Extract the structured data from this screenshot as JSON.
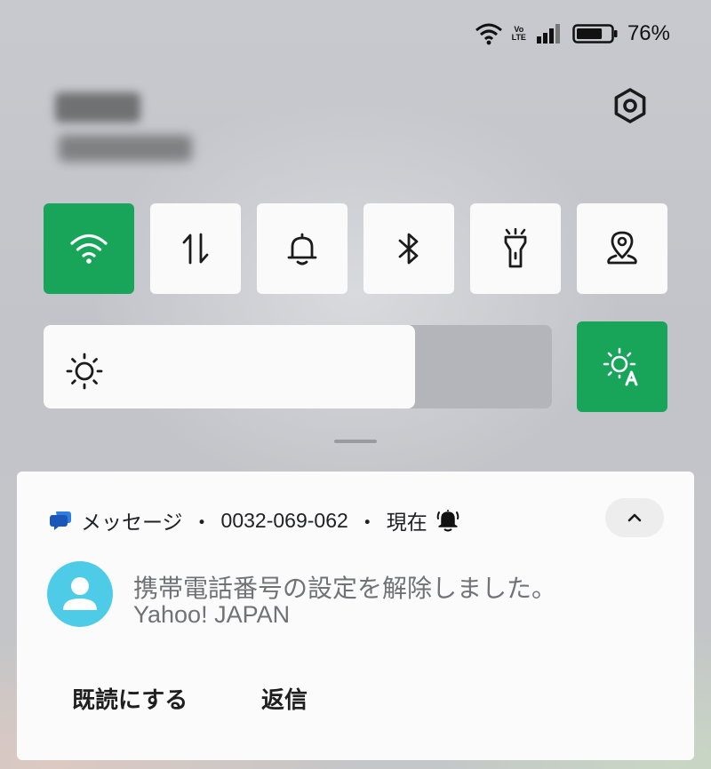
{
  "status_bar": {
    "battery_percent": "76%",
    "battery_level": 0.76,
    "signal_tech": [
      "Vo",
      "LTE"
    ],
    "icons": [
      "wifi-icon",
      "volte-icon",
      "cell-signal-icon",
      "battery-icon"
    ]
  },
  "header": {
    "settings_icon": "gear-icon"
  },
  "quick_tiles": [
    {
      "name": "wifi",
      "icon": "wifi-icon",
      "active": true
    },
    {
      "name": "mobile-data",
      "icon": "data-arrows-icon",
      "active": false
    },
    {
      "name": "sound",
      "icon": "bell-icon",
      "active": false
    },
    {
      "name": "bluetooth",
      "icon": "bluetooth-icon",
      "active": false
    },
    {
      "name": "flashlight",
      "icon": "flashlight-icon",
      "active": false
    },
    {
      "name": "location",
      "icon": "location-icon",
      "active": false
    }
  ],
  "brightness": {
    "level": 0.73,
    "icon": "sun-icon",
    "auto_icon": "auto-brightness-icon",
    "auto_active": true
  },
  "notification": {
    "app_name": "メッセージ",
    "sender": "0032-069-062",
    "time": "現在",
    "separator": "・",
    "title": "携帯電話番号の設定を解除しました。",
    "subtitle": "Yahoo! JAPAN",
    "actions": {
      "mark_read": "既読にする",
      "reply": "返信"
    }
  },
  "colors": {
    "accent": "#18a55a",
    "avatar": "#4ecbe6",
    "tile": "#fafafa"
  }
}
